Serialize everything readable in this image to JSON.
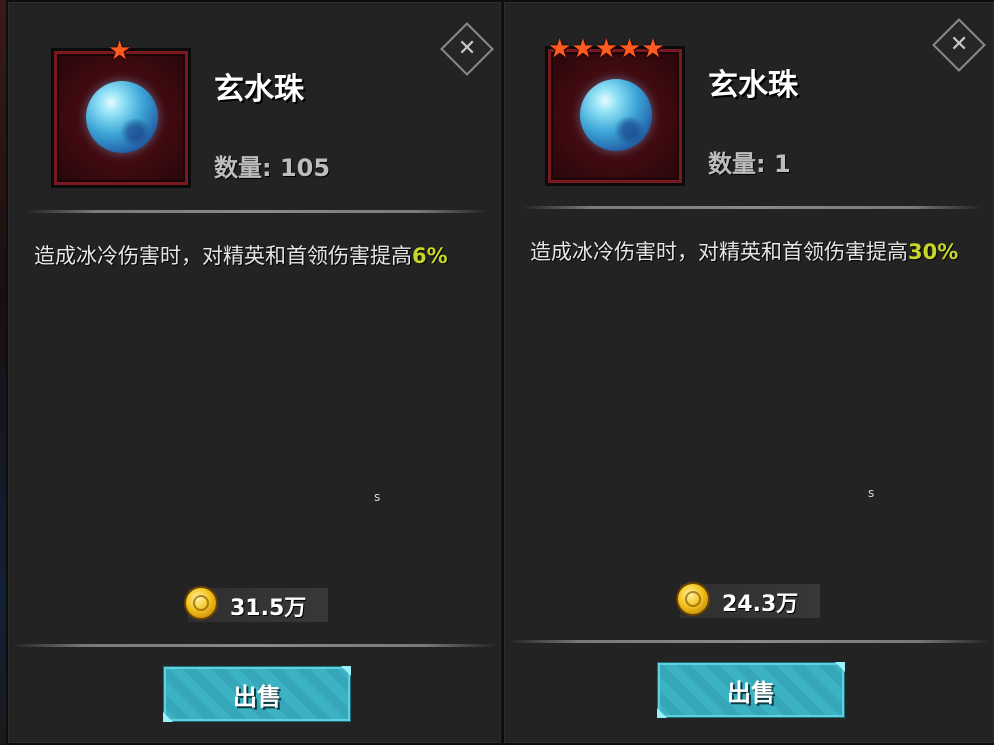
{
  "panels": [
    {
      "item_name": "玄水珠",
      "star_count": 1,
      "stars": "★",
      "quantity_text": "数量: 105",
      "description_main": "造成冰冷伤害时，对精英和首领伤害提高",
      "description_highlight": "6%",
      "stray_char": "s",
      "price": "31.5万",
      "sell_label": "出售",
      "close_symbol": "✕"
    },
    {
      "item_name": "玄水珠",
      "star_count": 5,
      "stars": "★★★★★",
      "quantity_text": "数量: 1",
      "description_main": "造成冰冷伤害时，对精英和首领伤害提高",
      "description_highlight": "30%",
      "stray_char": "s",
      "price": "24.3万",
      "sell_label": "出售",
      "close_symbol": "✕"
    }
  ],
  "colors": {
    "highlight": "#c8d62a",
    "star": "#ff5a1f",
    "sell_button": "#3cb3c3",
    "panel_bg": "#232323",
    "frame_red": "#5a0f16"
  },
  "icons": {
    "item": "blue-water-orb-icon",
    "currency": "gold-coin-icon",
    "close": "close-icon",
    "rarity": "star-icon"
  }
}
